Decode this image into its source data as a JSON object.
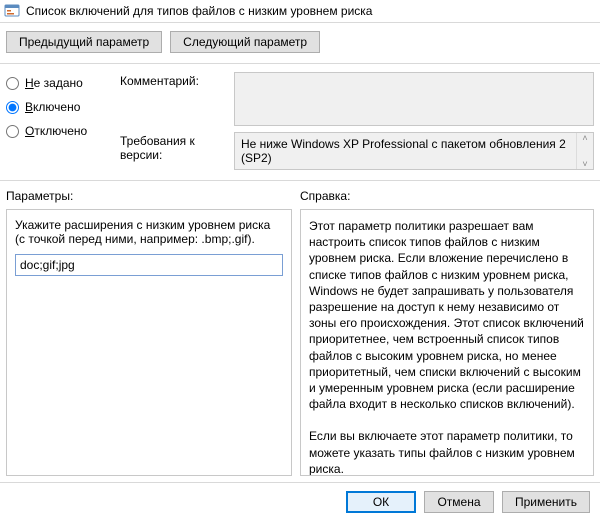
{
  "window": {
    "title": "Список включений для типов файлов с низким уровнем риска"
  },
  "nav": {
    "prev": "Предыдущий параметр",
    "next": "Следующий параметр"
  },
  "state": {
    "not_configured_prefix": "Н",
    "not_configured_rest": "е задано",
    "enabled_prefix": "В",
    "enabled_rest": "ключено",
    "disabled_prefix": "О",
    "disabled_rest": "тключено"
  },
  "comment": {
    "label": "Комментарий:",
    "value": ""
  },
  "requirements": {
    "label": "Требования к версии:",
    "value": "Не ниже Windows XP Professional с пакетом обновления 2 (SP2)",
    "up": "˄",
    "down": "˅"
  },
  "sections": {
    "params_label": "Параметры:",
    "help_label": "Справка:"
  },
  "params": {
    "ext_label": "Укажите расширения с низким уровнем риска (с точкой перед ними, например: .bmp;.gif).",
    "ext_value": "doc;gif;jpg"
  },
  "help": {
    "text": "Этот параметр политики разрешает вам настроить список типов файлов с низким уровнем риска. Если вложение перечислено в списке типов файлов с низким уровнем риска, Windows не будет запрашивать у пользователя разрешение на доступ к нему независимо от зоны его происхождения. Этот список включений приоритетнее, чем встроенный список типов файлов с высоким уровнем риска, но менее приоритетный, чем списки включений с высоким и умеренным уровнем риска (если расширение файла входит в несколько списков включений).\n\nЕсли вы включаете этот параметр политики, то можете указать типы файлов с низким уровнем риска.\n\nЕсли вы отключаете этот параметр политики, Windows использует логику доверия по умолчанию.\n\nЕсли вы не настраиваете этот параметр политики, Windows использует логику доверия по умолчанию."
  },
  "footer": {
    "ok": "ОК",
    "cancel": "Отмена",
    "apply": "Применить"
  }
}
